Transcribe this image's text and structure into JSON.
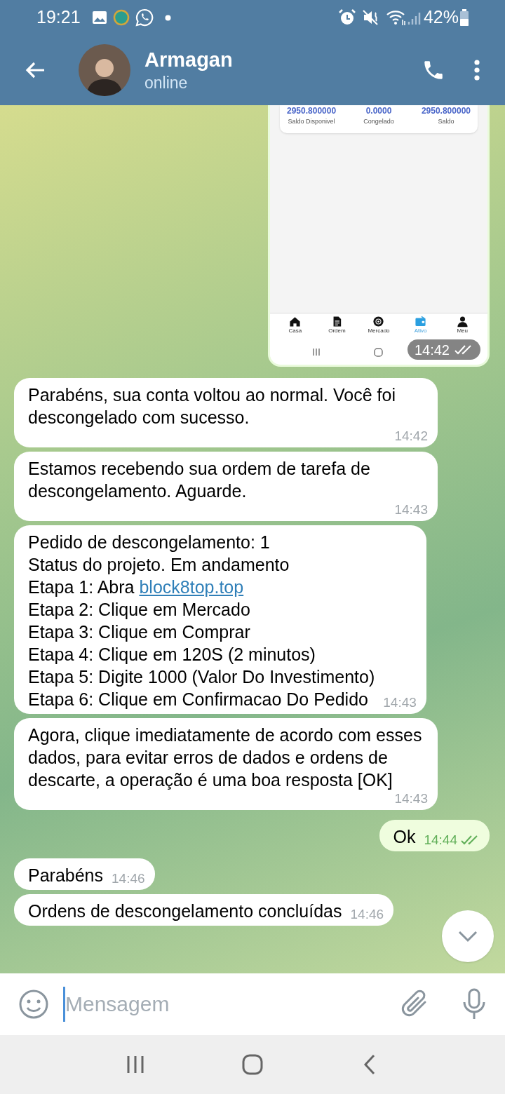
{
  "status_bar": {
    "time": "19:21",
    "battery": "42%"
  },
  "header": {
    "name": "Armagan",
    "status": "online"
  },
  "messages": [
    {
      "kind": "screenshot",
      "time": "14:42",
      "read": true,
      "balances": [
        {
          "amount": "2950.800000",
          "label": "Saldo Disponivel"
        },
        {
          "amount": "0.0000",
          "label": "Congelado"
        },
        {
          "amount": "2950.800000",
          "label": "Saldo"
        }
      ],
      "nav": [
        {
          "label": "Casa",
          "selected": false
        },
        {
          "label": "Ordem",
          "selected": false
        },
        {
          "label": "Mercado",
          "selected": false
        },
        {
          "label": "Ativo",
          "selected": true
        },
        {
          "label": "Meu",
          "selected": false
        }
      ]
    },
    {
      "kind": "incoming",
      "lines": [
        {
          "text": "Parabéns, sua conta voltou ao normal. Você foi descongelado com sucesso."
        }
      ],
      "time": "14:42"
    },
    {
      "kind": "incoming",
      "lines": [
        {
          "text": "Estamos recebendo sua ordem de tarefa de descongelamento. Aguarde."
        }
      ],
      "time": "14:43"
    },
    {
      "kind": "incoming",
      "lines": [
        {
          "text": "Pedido de descongelamento: 1"
        },
        {
          "text": "Status do projeto. Em andamento"
        },
        {
          "text": "Etapa 1: Abra ",
          "link": "block8top.top"
        },
        {
          "text": "Etapa 2: Clique em Mercado"
        },
        {
          "text": "Etapa 3: Clique em Comprar"
        },
        {
          "text": "Etapa 4: Clique em 120S (2 minutos)"
        },
        {
          "text": "Etapa 5: Digite 1000 (Valor Do Investimento)"
        },
        {
          "text": "Etapa 6: Clique em Confirmacao Do Pedido"
        }
      ],
      "time": "14:43"
    },
    {
      "kind": "incoming",
      "lines": [
        {
          "text": "Agora, clique imediatamente de acordo com esses dados, para evitar erros de dados e ordens de descarte, a operação é uma boa resposta [OK]"
        }
      ],
      "time": "14:43"
    },
    {
      "kind": "outgoing",
      "lines": [
        {
          "text": "Ok"
        }
      ],
      "time": "14:44",
      "read": true
    },
    {
      "kind": "incoming",
      "lines": [
        {
          "text": "Parabéns"
        }
      ],
      "time": "14:46"
    },
    {
      "kind": "incoming",
      "lines": [
        {
          "text": "Ordens de descongelamento concluídas"
        }
      ],
      "time": "14:46"
    }
  ],
  "composer": {
    "placeholder": "Mensagem"
  }
}
